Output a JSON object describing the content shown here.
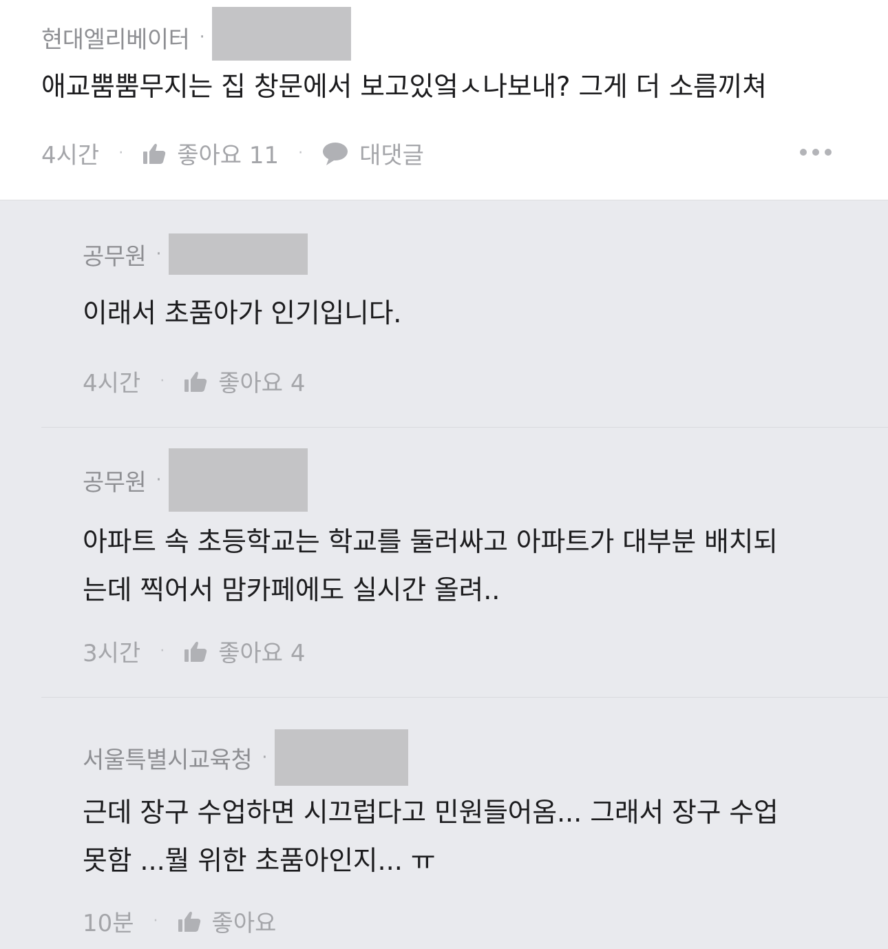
{
  "main_comment": {
    "author": "현대엘리베이터",
    "text": "애교뿜뿜무지는 집 창문에서 보고있엌ㅅ나보내? 그게 더 소름끼쳐",
    "time": "4시간",
    "like_label": "좋아요 11",
    "reply_label": "대댓글"
  },
  "replies": [
    {
      "author": "공무원",
      "text_lines": [
        "이래서 초품아가 인기입니다."
      ],
      "time": "4시간",
      "like_label": "좋아요 4"
    },
    {
      "author": "공무원",
      "text_lines": [
        "아파트 속 초등학교는 학교를 둘러싸고 아파트가 대부분 배치되",
        "는데 찍어서 맘카페에도 실시간 올려.."
      ],
      "time": "3시간",
      "like_label": "좋아요 4"
    },
    {
      "author": "서울특별시교육청",
      "text_lines": [
        "근데 장구 수업하면 시끄럽다고 민원들어옴... 그래서 장구 수업",
        "못함 ...뭘 위한 초품아인지... ㅠ"
      ],
      "time": "10분",
      "like_label": "좋아요"
    }
  ],
  "colors": {
    "reply_background": "#e9eaee",
    "redaction": "#c4c4c6",
    "meta_text": "#a4a5a9"
  },
  "icons": [
    "thumbs-up-icon",
    "speech-bubble-icon",
    "more-dots-icon"
  ]
}
